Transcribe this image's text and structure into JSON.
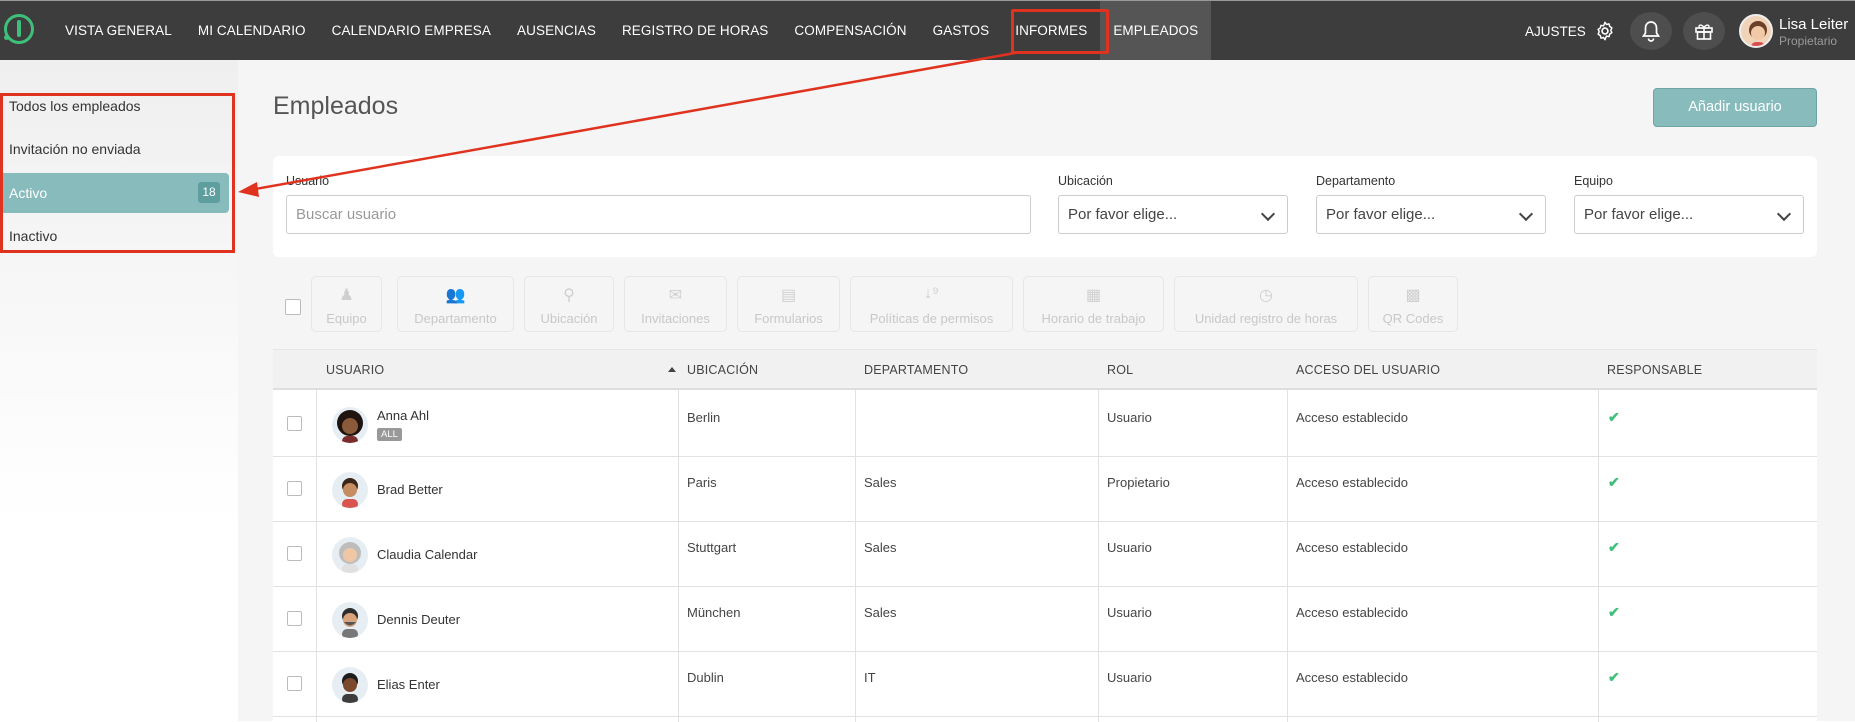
{
  "topbar": {
    "nav": [
      "VISTA GENERAL",
      "MI CALENDARIO",
      "CALENDARIO EMPRESA",
      "AUSENCIAS",
      "REGISTRO DE HORAS",
      "COMPENSACIÓN",
      "GASTOS",
      "INFORMES",
      "EMPLEADOS"
    ],
    "active_nav": "EMPLEADOS",
    "settings_label": "AJUSTES",
    "user_name": "Lisa Leiter",
    "user_role": "Propietario"
  },
  "sidebar": {
    "all": "Todos los empleados",
    "not_sent": "Invitación no enviada",
    "active": "Activo",
    "active_count": "18",
    "inactive": "Inactivo"
  },
  "page": {
    "title": "Empleados",
    "add_button": "Añadir usuario"
  },
  "filters": {
    "user_label": "Usuario",
    "user_placeholder": "Buscar usuario",
    "location_label": "Ubicación",
    "department_label": "Departamento",
    "team_label": "Equipo",
    "select_value": "Por favor elige..."
  },
  "toolbar": [
    "Equipo",
    "Departamento",
    "Ubicación",
    "Invitaciones",
    "Formularios",
    "Políticas de permisos",
    "Horario de trabajo",
    "Unidad registro de horas",
    "QR Codes"
  ],
  "table": {
    "headers": [
      "USUARIO",
      "UBICACIÓN",
      "DEPARTAMENTO",
      "ROL",
      "ACCESO DEL USUARIO",
      "RESPONSABLE"
    ],
    "rows": [
      {
        "name": "Anna Ahl",
        "tag": "ALL",
        "location": "Berlin",
        "department": "",
        "role": "Usuario",
        "access": "Acceso establecido"
      },
      {
        "name": "Brad Better",
        "tag": "",
        "location": "Paris",
        "department": "Sales",
        "role": "Propietario",
        "access": "Acceso establecido"
      },
      {
        "name": "Claudia Calendar",
        "tag": "",
        "location": "Stuttgart",
        "department": "Sales",
        "role": "Usuario",
        "access": "Acceso establecido"
      },
      {
        "name": "Dennis Deuter",
        "tag": "",
        "location": "München",
        "department": "Sales",
        "role": "Usuario",
        "access": "Acceso establecido"
      },
      {
        "name": "Elias Enter",
        "tag": "",
        "location": "Dublin",
        "department": "IT",
        "role": "Usuario",
        "access": "Acceso establecido"
      }
    ]
  },
  "colors": {
    "accent": "#88bcbc",
    "highlight": "#e0331f",
    "check": "#3ec07a"
  }
}
